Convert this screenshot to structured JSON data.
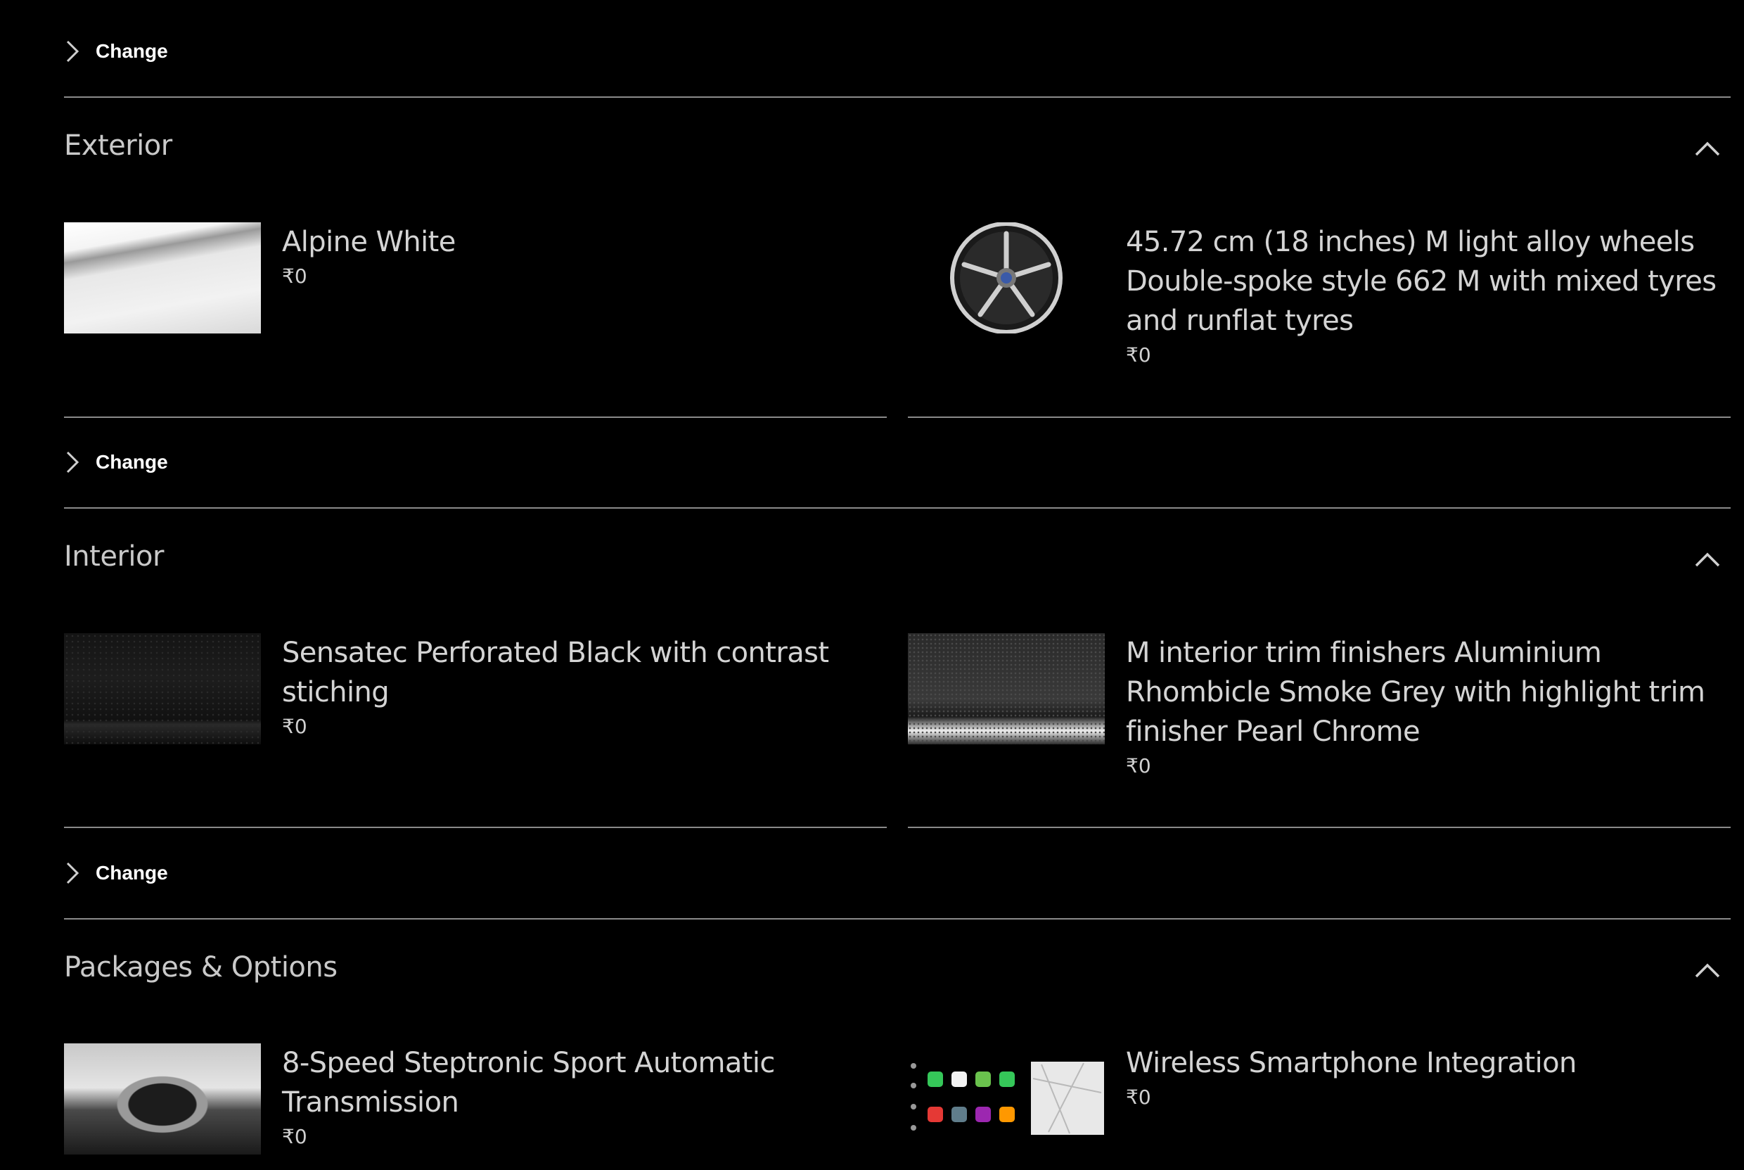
{
  "change_label": "Change",
  "sections": {
    "exterior": {
      "title": "Exterior",
      "items": [
        {
          "name": "Alpine White",
          "price": "₹0",
          "thumb": "paint-swatch-alpine-white"
        },
        {
          "name": "45.72 cm (18 inches) M light alloy wheels Double-spoke style 662 M with mixed tyres and runflat tyres",
          "price": "₹0",
          "thumb": "alloy-wheel"
        }
      ]
    },
    "interior": {
      "title": "Interior",
      "items": [
        {
          "name": "Sensatec Perforated Black with contrast stiching",
          "price": "₹0",
          "thumb": "upholstery-swatch"
        },
        {
          "name": "M interior trim finishers Aluminium Rhombicle Smoke Grey with highlight trim finisher Pearl Chrome",
          "price": "₹0",
          "thumb": "trim-swatch"
        }
      ]
    },
    "packages": {
      "title": "Packages & Options",
      "items": [
        {
          "name": "8-Speed Steptronic Sport Automatic Transmission",
          "price": "₹0",
          "thumb": "steering-wheel"
        },
        {
          "name": "Wireless Smartphone Integration",
          "price": "₹0",
          "thumb": "carplay-screen"
        }
      ]
    }
  },
  "colors": {
    "background": "#000000",
    "divider": "#8a8a8a",
    "text": "#d4d4d4"
  }
}
